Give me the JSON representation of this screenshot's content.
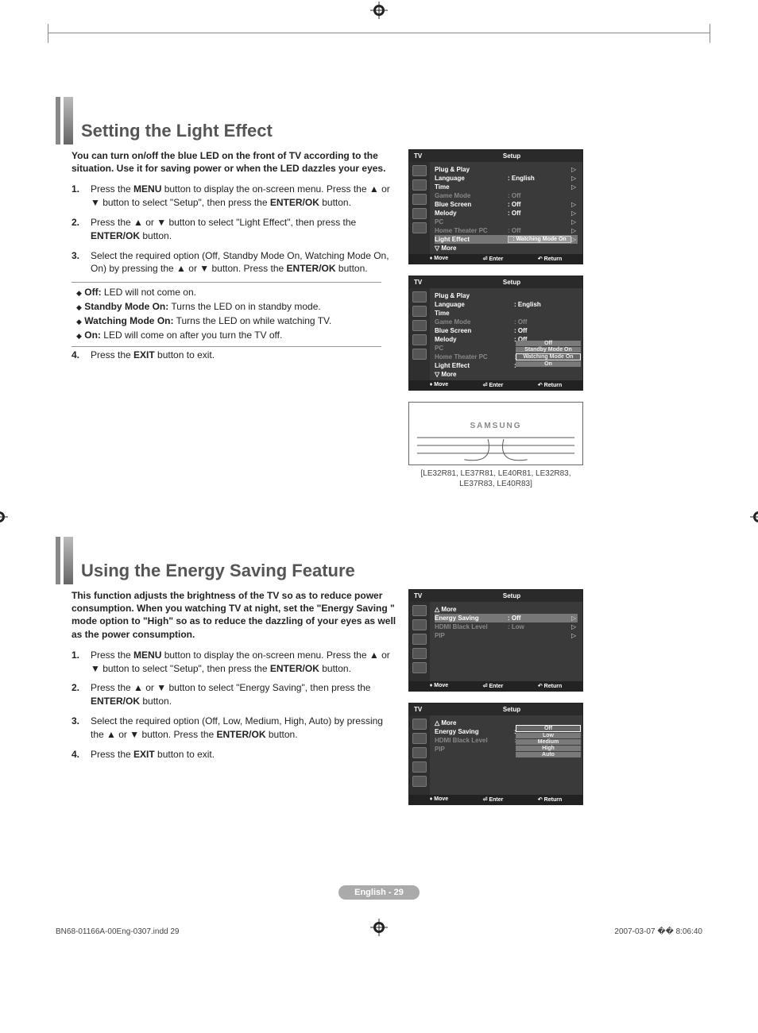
{
  "section1": {
    "title": "Setting the Light Effect",
    "intro": "You can turn on/off the blue LED on the front of TV according to the situation. Use it for saving power or when the LED dazzles your eyes.",
    "steps": [
      {
        "num": "1.",
        "html": "Press the <b>MENU</b> button to display the on-screen menu. Press the ▲ or ▼ button to select \"Setup\", then press the <b>ENTER/OK</b> button."
      },
      {
        "num": "2.",
        "html": "Press the ▲ or ▼ button to select \"Light Effect\", then press the <b>ENTER/OK</b> button."
      },
      {
        "num": "3.",
        "html": "Select the required option (Off, Standby Mode On, Watching Mode On, On) by pressing the ▲ or ▼ button. Press the <b>ENTER/OK</b> button."
      }
    ],
    "options": [
      {
        "label": "Off:",
        "text": " LED will not come on."
      },
      {
        "label": "Standby Mode On:",
        "text": " Turns the LED on in standby mode."
      },
      {
        "label": "Watching Mode On:",
        "text": " Turns the LED on while watching TV."
      },
      {
        "label": "On:",
        "text": " LED will come on after you turn the TV off."
      }
    ],
    "step4": {
      "num": "4.",
      "html": "Press the <b>EXIT</b> button to exit."
    }
  },
  "osd_common": {
    "tv": "TV",
    "setup": "Setup",
    "foot_move": "Move",
    "foot_enter": "Enter",
    "foot_return": "Return"
  },
  "osd1": {
    "rows": [
      {
        "l": "Plug & Play",
        "v": "",
        "a": "▷",
        "dim": false
      },
      {
        "l": "Language",
        "v": ": English",
        "a": "▷",
        "dim": false
      },
      {
        "l": "Time",
        "v": "",
        "a": "▷",
        "dim": false
      },
      {
        "l": "Game Mode",
        "v": ": Off",
        "a": "",
        "dim": true
      },
      {
        "l": "Blue Screen",
        "v": ": Off",
        "a": "▷",
        "dim": false
      },
      {
        "l": "Melody",
        "v": ": Off",
        "a": "▷",
        "dim": false
      },
      {
        "l": "PC",
        "v": "",
        "a": "▷",
        "dim": true
      },
      {
        "l": "Home Theater PC",
        "v": ": Off",
        "a": "▷",
        "dim": true
      }
    ],
    "hl": {
      "l": "Light Effect",
      "v": ": Watching Mode On",
      "a": "▷"
    },
    "more": "▽ More"
  },
  "osd2": {
    "rows": [
      {
        "l": "Plug & Play",
        "v": "",
        "dim": false
      },
      {
        "l": "Language",
        "v": ": English",
        "dim": false
      },
      {
        "l": "Time",
        "v": "",
        "dim": false
      },
      {
        "l": "Game Mode",
        "v": ": Off",
        "dim": true
      },
      {
        "l": "Blue Screen",
        "v": ": Off",
        "dim": false
      },
      {
        "l": "Melody",
        "v": ": Off",
        "dim": false
      },
      {
        "l": "PC",
        "v": "",
        "dim": true
      },
      {
        "l": "Home Theater PC",
        "v": ":",
        "dim": true
      },
      {
        "l": "Light Effect",
        "v": ":",
        "dim": false
      }
    ],
    "opts": [
      "Off",
      "Standby Mode On",
      "Watching Mode On",
      "On"
    ],
    "sel_index": 2,
    "more": "▽ More"
  },
  "tv_brand": "SAMSUNG",
  "models": "[LE32R81, LE37R81, LE40R81, LE32R83, LE37R83, LE40R83]",
  "section2": {
    "title": "Using the Energy Saving Feature",
    "intro": "This function adjusts the brightness of the TV so as to reduce power consumption. When you watching TV at night, set the \"Energy Saving \" mode option to \"High\" so as to reduce the dazzling of your eyes as well as the power consumption.",
    "steps": [
      {
        "num": "1.",
        "html": "Press the <b>MENU</b> button to display the on-screen menu. Press the ▲ or ▼ button to select \"Setup\", then press the <b>ENTER/OK</b> button."
      },
      {
        "num": "2.",
        "html": "Press the ▲ or ▼ button to select \"Energy Saving\", then press the <b>ENTER/OK</b> button."
      },
      {
        "num": "3.",
        "html": "Select the required option (Off, Low, Medium, High, Auto) by pressing the ▲ or ▼ button. Press the <b>ENTER/OK</b> button."
      },
      {
        "num": "4.",
        "html": "Press the <b>EXIT</b> button to exit."
      }
    ]
  },
  "osd3": {
    "more": "△ More",
    "hl": {
      "l": "Energy Saving",
      "v": ": Off",
      "a": "▷"
    },
    "rows": [
      {
        "l": "HDMI Black Level",
        "v": ": Low",
        "a": "▷",
        "dim": true
      },
      {
        "l": "PIP",
        "v": "",
        "a": "▷",
        "dim": true
      }
    ]
  },
  "osd4": {
    "more": "△ More",
    "row": {
      "l": "Energy Saving",
      "v": ":",
      "dim": false
    },
    "rows_after": [
      {
        "l": "HDMI Black Level",
        "v": ":",
        "dim": true
      },
      {
        "l": "PIP",
        "v": "",
        "dim": true
      }
    ],
    "opts": [
      "Off",
      "Low",
      "Medium",
      "High",
      "Auto"
    ],
    "sel_index": 0
  },
  "page_label": "English - 29",
  "imprint_file": "BN68-01166A-00Eng-0307.indd   29",
  "imprint_time": "2007-03-07   �� 8:06:40"
}
